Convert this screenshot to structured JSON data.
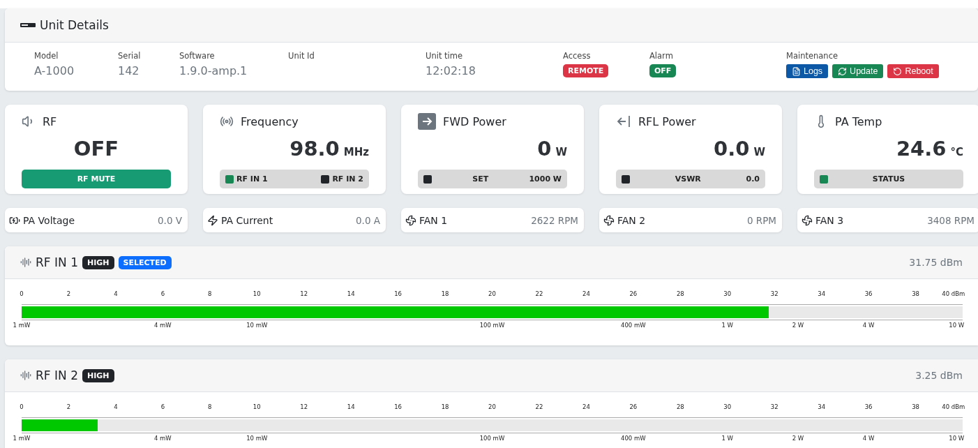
{
  "unit_details": {
    "title": "Unit Details",
    "fields": [
      {
        "kind": "text",
        "label": "Model",
        "value": "A-1000"
      },
      {
        "kind": "text",
        "label": "Serial",
        "value": "142"
      },
      {
        "kind": "text",
        "label": "Software",
        "value": "1.9.0-amp.1"
      },
      {
        "kind": "text",
        "label": "Unit Id"
      },
      {
        "kind": "text",
        "label": "Unit time",
        "value": "12:02:18"
      },
      {
        "kind": "badge",
        "label": "Access",
        "value": "REMOTE",
        "color": "#dc3545"
      },
      {
        "kind": "badge",
        "label": "Alarm",
        "value": "OFF",
        "color": "#198754"
      },
      {
        "kind": "buttons",
        "label": "Maintenance",
        "buttons": [
          {
            "label": "Logs",
            "color": "#0d58a6"
          },
          {
            "label": "Update",
            "color": "#198754"
          },
          {
            "label": "Reboot",
            "color": "#dc3545"
          }
        ]
      }
    ]
  },
  "stat_cards": [
    {
      "title": "RF",
      "value": "OFF",
      "footer": {
        "kind": "button",
        "label": "RF MUTE"
      }
    },
    {
      "title": "Frequency",
      "value": "98.0",
      "unit": "MHz",
      "footer": {
        "kind": "inputs",
        "items": [
          {
            "label": "RF IN 1",
            "selected": true
          },
          {
            "label": "RF IN 2",
            "selected": false
          }
        ]
      }
    },
    {
      "title": "FWD Power",
      "value": "0",
      "unit": "W",
      "footer": {
        "kind": "status",
        "on": false,
        "label": "SET",
        "value": "1000 W"
      }
    },
    {
      "title": "RFL Power",
      "value": "0.0",
      "unit": "W",
      "footer": {
        "kind": "status",
        "on": false,
        "label": "VSWR",
        "value": "0.0"
      }
    },
    {
      "title": "PA Temp",
      "value": "24.6",
      "unit": "°C",
      "footer": {
        "kind": "status",
        "on": true,
        "label": "STATUS"
      }
    }
  ],
  "readings": [
    {
      "label": "PA Voltage",
      "value": "0.0 V"
    },
    {
      "label": "PA Current",
      "value": "0.0 A"
    },
    {
      "label": "FAN 1",
      "value": "2622 RPM"
    },
    {
      "label": "FAN 2",
      "value": "0 RPM"
    },
    {
      "label": "FAN 3",
      "value": "3408 RPM"
    }
  ],
  "rf_inputs": [
    {
      "title": "RF IN 1",
      "badges": [
        {
          "label": "HIGH",
          "color": "#212529"
        },
        {
          "label": "SELECTED",
          "color": "#0d6efd"
        }
      ],
      "reading": "31.75 dBm",
      "level": 0.794,
      "dbm_ticks": [
        "0",
        "2",
        "4",
        "6",
        "8",
        "10",
        "12",
        "14",
        "16",
        "18",
        "20",
        "22",
        "24",
        "26",
        "28",
        "30",
        "32",
        "34",
        "36",
        "38",
        "40 dBm"
      ],
      "power_ticks": [
        "1 mW",
        "4 mW",
        "10 mW",
        "100 mW",
        "400 mW",
        "1 W",
        "2 W",
        "4 W",
        "10 W"
      ]
    },
    {
      "title": "RF IN 2",
      "badges": [
        {
          "label": "HIGH",
          "color": "#212529"
        }
      ],
      "reading": "3.25 dBm",
      "level": 0.081,
      "dbm_ticks": [
        "0",
        "2",
        "4",
        "6",
        "8",
        "10",
        "12",
        "14",
        "16",
        "18",
        "20",
        "22",
        "24",
        "26",
        "28",
        "30",
        "32",
        "34",
        "36",
        "38",
        "40 dBm"
      ],
      "power_ticks": [
        "1 mW",
        "4 mW",
        "10 mW",
        "100 mW",
        "400 mW",
        "1 W",
        "2 W",
        "4 W",
        "10 W"
      ]
    }
  ]
}
